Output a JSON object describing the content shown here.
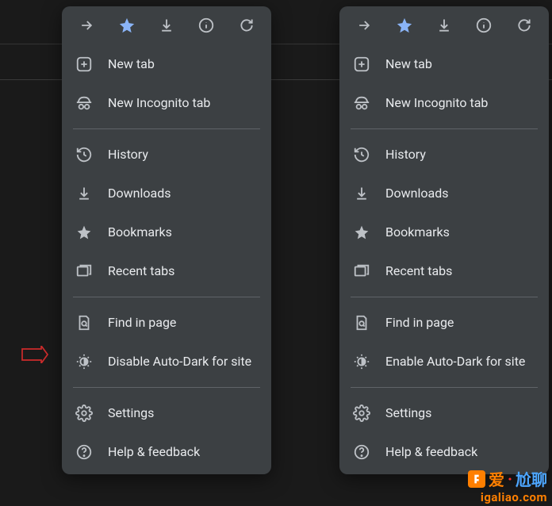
{
  "toolbar": [
    {
      "name": "forward-icon"
    },
    {
      "name": "star-icon"
    },
    {
      "name": "download-icon"
    },
    {
      "name": "info-icon"
    },
    {
      "name": "reload-icon"
    }
  ],
  "menus": {
    "left": {
      "auto_dark_label": "Disable Auto-Dark for site"
    },
    "right": {
      "auto_dark_label": "Enable Auto-Dark for site"
    },
    "common": {
      "new_tab": "New tab",
      "new_incognito_tab": "New Incognito tab",
      "history": "History",
      "downloads": "Downloads",
      "bookmarks": "Bookmarks",
      "recent_tabs": "Recent tabs",
      "find_in_page": "Find in page",
      "settings": "Settings",
      "help_feedback": "Help & feedback"
    }
  },
  "annotation": {
    "arrow_color": "#cc2b2b"
  },
  "watermark": {
    "text1": "爱",
    "text2": "尬聊",
    "url": "igaliao.com"
  }
}
